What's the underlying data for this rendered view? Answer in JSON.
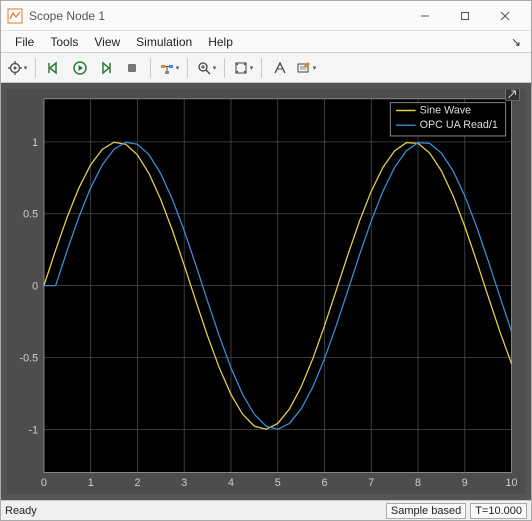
{
  "window": {
    "title": "Scope Node 1"
  },
  "menu": {
    "items": [
      "File",
      "Tools",
      "View",
      "Simulation",
      "Help"
    ]
  },
  "status": {
    "ready": "Ready",
    "sample": "Sample based",
    "time": "T=10.000"
  },
  "legend": {
    "series1": "Sine Wave",
    "series2": "OPC UA Read/1"
  },
  "chart_data": {
    "type": "line",
    "xlabel": "",
    "ylabel": "",
    "xlim": [
      0,
      10
    ],
    "ylim": [
      -1.3,
      1.3
    ],
    "xticks": [
      0,
      1,
      2,
      3,
      4,
      5,
      6,
      7,
      8,
      9,
      10
    ],
    "yticks": [
      -1,
      -0.5,
      0,
      0.5,
      1
    ],
    "series": [
      {
        "name": "Sine Wave",
        "color": "#e6d050",
        "x": [
          0,
          0.25,
          0.5,
          0.75,
          1,
          1.25,
          1.5,
          1.75,
          2,
          2.25,
          2.5,
          2.75,
          3,
          3.25,
          3.5,
          3.75,
          4,
          4.25,
          4.5,
          4.75,
          5,
          5.25,
          5.5,
          5.75,
          6,
          6.25,
          6.5,
          6.75,
          7,
          7.25,
          7.5,
          7.75,
          8,
          8.25,
          8.5,
          8.75,
          9,
          9.25,
          9.5,
          9.75,
          10
        ],
        "values": [
          0.0,
          0.2474,
          0.4794,
          0.6816,
          0.8415,
          0.949,
          0.9975,
          0.9839,
          0.9093,
          0.7781,
          0.5985,
          0.3817,
          0.1411,
          -0.1082,
          -0.3508,
          -0.5716,
          -0.7568,
          -0.895,
          -0.9775,
          -0.9993,
          -0.9589,
          -0.8589,
          -0.7055,
          -0.5083,
          -0.2794,
          -0.0332,
          0.2151,
          0.45,
          0.657,
          0.8231,
          0.938,
          0.9946,
          0.9894,
          0.9224,
          0.7985,
          0.6248,
          0.4121,
          0.1736,
          -0.0752,
          -0.3195,
          -0.544
        ]
      },
      {
        "name": "OPC UA Read/1",
        "color": "#3a8fd8",
        "x": [
          0,
          0.25,
          0.5,
          0.75,
          1,
          1.25,
          1.5,
          1.75,
          2,
          2.25,
          2.5,
          2.75,
          3,
          3.25,
          3.5,
          3.75,
          4,
          4.25,
          4.5,
          4.75,
          5,
          5.25,
          5.5,
          5.75,
          6,
          6.25,
          6.5,
          6.75,
          7,
          7.25,
          7.5,
          7.75,
          8,
          8.25,
          8.5,
          8.75,
          9,
          9.25,
          9.5,
          9.75,
          10
        ],
        "values": [
          0.0,
          0.0,
          0.2474,
          0.4794,
          0.6816,
          0.8415,
          0.949,
          0.9975,
          0.9839,
          0.9093,
          0.7781,
          0.5985,
          0.3817,
          0.1411,
          -0.1082,
          -0.3508,
          -0.5716,
          -0.7568,
          -0.895,
          -0.9775,
          -0.9993,
          -0.9589,
          -0.8589,
          -0.7055,
          -0.5083,
          -0.2794,
          -0.0332,
          0.2151,
          0.45,
          0.657,
          0.8231,
          0.938,
          0.9946,
          0.9894,
          0.9224,
          0.7985,
          0.6248,
          0.4121,
          0.1736,
          -0.0752,
          -0.3195
        ]
      }
    ]
  },
  "toolbar": {
    "buttons": [
      "settings",
      "step-back",
      "run",
      "step-fwd",
      "stop",
      "signal-select",
      "zoom",
      "pan",
      "cursor",
      "props"
    ]
  }
}
